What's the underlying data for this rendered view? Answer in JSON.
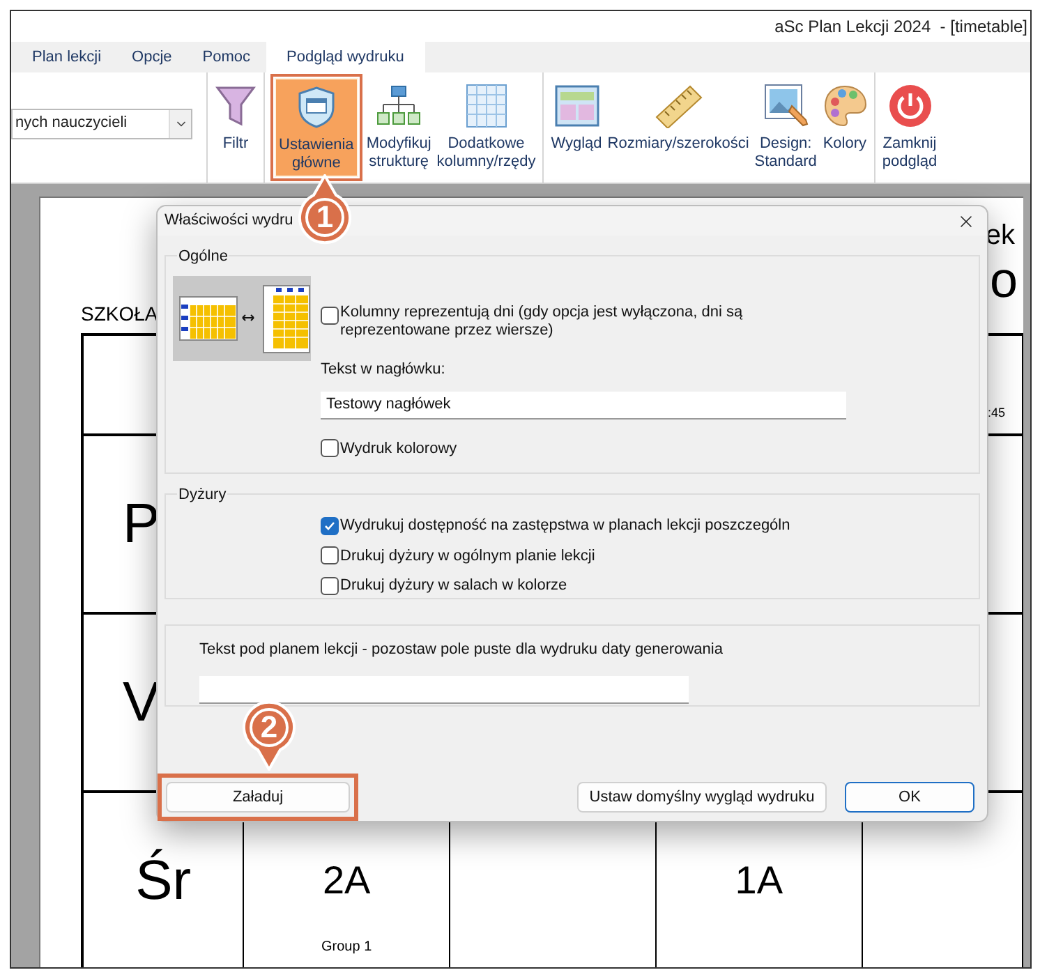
{
  "window": {
    "title": "aSc Plan Lekcji 2024  - [timetable]"
  },
  "tabs": [
    {
      "label": "Plan lekcji",
      "selected": false
    },
    {
      "label": "Opcje",
      "selected": false
    },
    {
      "label": "Pomoc",
      "selected": false
    },
    {
      "label": "Podgląd wydruku",
      "selected": true
    }
  ],
  "ribbon": {
    "dropdown": {
      "value": "nych nauczycieli"
    },
    "groups": [
      [
        {
          "kind": "filter",
          "label": "Filtr",
          "highlighted": false
        }
      ],
      [
        {
          "kind": "settings",
          "label": "Ustawienia\ngłówne",
          "highlighted": true
        },
        {
          "kind": "structure",
          "label": "Modyfikuj\nstrukturę",
          "highlighted": false
        },
        {
          "kind": "grid",
          "label": "Dodatkowe\nkolumny/rzędy",
          "highlighted": false
        }
      ],
      [
        {
          "kind": "layout",
          "label": "Wygląd",
          "highlighted": false
        },
        {
          "kind": "ruler",
          "label": "Rozmiary/szerokości",
          "highlighted": false
        },
        {
          "kind": "design",
          "label": "Design:\nStandard",
          "highlighted": false
        },
        {
          "kind": "palette",
          "label": "Kolory",
          "highlighted": false
        }
      ],
      [
        {
          "kind": "power",
          "label": "Zamknij\npodgląd",
          "highlighted": false
        }
      ]
    ]
  },
  "page": {
    "school": "SZKOŁA",
    "title_lines": [
      "ek",
      "o"
    ],
    "time": ":45",
    "days": [
      "P",
      "V",
      "Śr"
    ],
    "cells": [
      {
        "text": "2A",
        "note": "Group 1"
      },
      {
        "text": "1A"
      }
    ]
  },
  "dialog": {
    "title": "Właściwości wydru",
    "general": {
      "legend": "Ogólne",
      "columns_option": {
        "label": "Kolumny reprezentują dni (gdy opcja jest wyłączona, dni są reprezentowane przez wiersze)",
        "checked": false
      },
      "header_label": "Tekst w nagłówku:",
      "header_value": "Testowy nagłówek",
      "color_option": {
        "label": "Wydruk kolorowy",
        "checked": false
      }
    },
    "duties": {
      "legend": "Dyżury",
      "options": [
        {
          "label": "Wydrukuj dostępność na zastępstwa w planach lekcji poszczególn",
          "checked": true
        },
        {
          "label": "Drukuj dyżury w ogólnym planie lekcji",
          "checked": false
        },
        {
          "label": "Drukuj dyżury w salach w kolorze",
          "checked": false
        }
      ]
    },
    "footer_label": "Tekst pod planem lekcji - pozostaw pole puste dla wydruku daty generowania",
    "buttons": [
      {
        "kind": "load",
        "label": "Załaduj",
        "highlighted": true
      },
      {
        "kind": "default",
        "label": "Ustaw domyślny wygląd wydruku",
        "highlighted": false
      },
      {
        "kind": "ok",
        "label": "OK",
        "highlighted": false
      }
    ]
  },
  "callouts": [
    {
      "number": "1"
    },
    {
      "number": "2"
    }
  ]
}
